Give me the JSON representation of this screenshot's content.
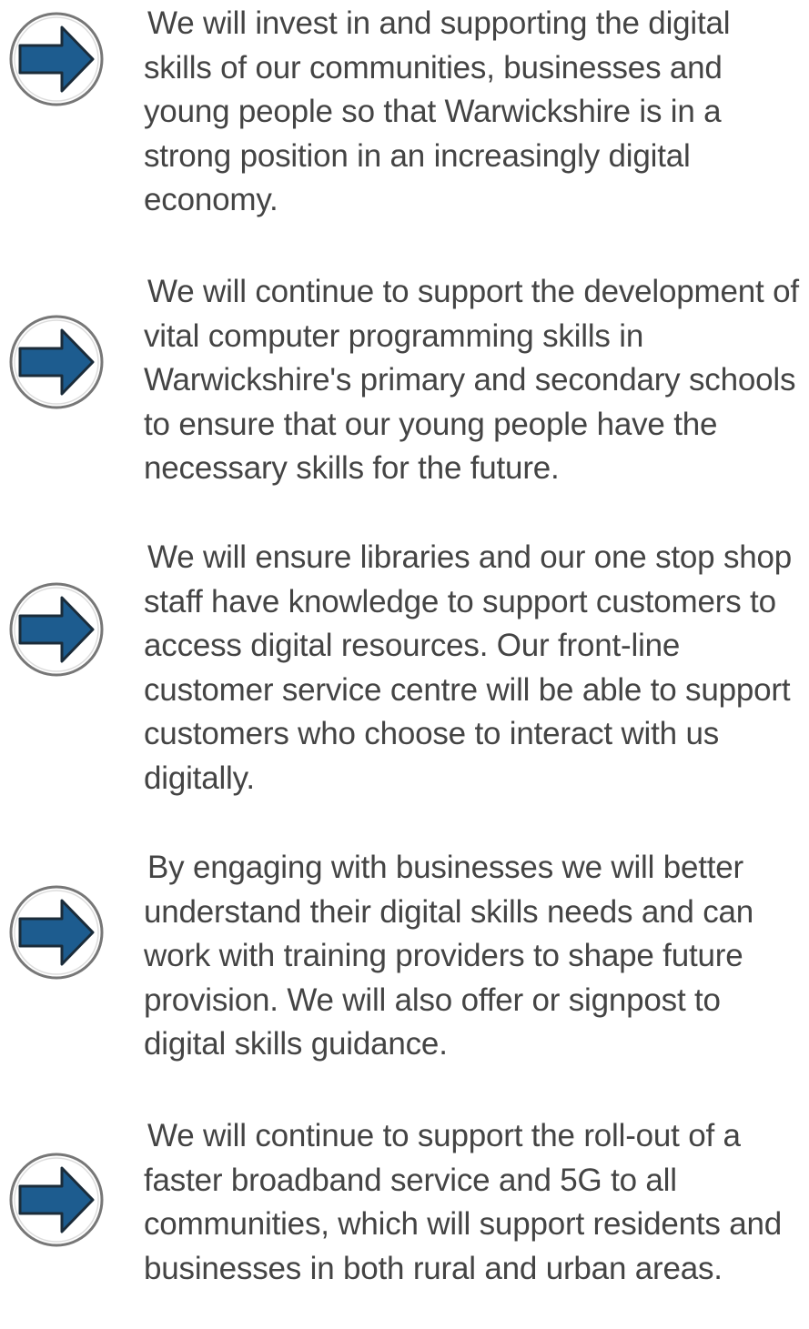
{
  "icons": {
    "bullet": "arrow-right-circle-icon"
  },
  "colors": {
    "arrow_fill": "#1d5c8f",
    "arrow_stroke": "#1b2c3a",
    "circle_stroke": "#777777",
    "text": "#444444",
    "background": "#ffffff"
  },
  "items": [
    {
      "text": "We will invest in and supporting the digital skills of our communities, businesses and young people so that Warwickshire is in a strong position in an increasingly digital economy."
    },
    {
      "text": "We will continue to support the development of vital computer programming skills in Warwickshire's primary and secondary schools to ensure that our young people have the necessary skills for the future."
    },
    {
      "text": "We will ensure libraries and our one stop shop staff have knowledge to support customers to access digital resources. Our front-line customer service centre will be able to support customers who choose to interact with us digitally."
    },
    {
      "text": "By engaging with businesses we will better understand their digital skills needs and can work with training providers to shape future provision. We will also offer or signpost to digital skills guidance."
    },
    {
      "text": "We will continue to support the roll-out of a faster broadband service and 5G to all communities, which will support residents and businesses in both rural and urban areas."
    }
  ]
}
